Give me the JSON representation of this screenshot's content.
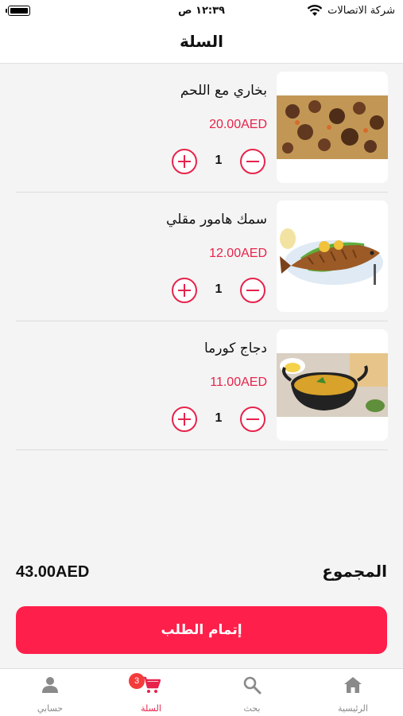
{
  "status_bar": {
    "carrier": "شركة الاتصالات",
    "time": "١٢:٣٩ ص"
  },
  "header": {
    "title": "السلة"
  },
  "cart": {
    "items": [
      {
        "name": "بخاري مع اللحم",
        "price": "20.00AED",
        "quantity": "1",
        "image": "bukhari-rice-with-meat"
      },
      {
        "name": "سمك هامور مقلي",
        "price": "12.00AED",
        "quantity": "1",
        "image": "fried-hammour-fish"
      },
      {
        "name": "دجاج كورما",
        "price": "11.00AED",
        "quantity": "1",
        "image": "chicken-korma-pot"
      }
    ]
  },
  "summary": {
    "total_label": "المجموع",
    "total_value": "43.00AED"
  },
  "checkout": {
    "label": "إتمام الطلب"
  },
  "tab_bar": {
    "tabs": [
      {
        "label": "حسابي",
        "icon": "person-icon"
      },
      {
        "label": "السلة",
        "icon": "cart-icon",
        "badge": "3",
        "active": true
      },
      {
        "label": "بحث",
        "icon": "search-icon"
      },
      {
        "label": "الرئيسية",
        "icon": "home-icon"
      }
    ]
  },
  "colors": {
    "accent": "#e7234b",
    "checkout_button": "#ff1f4b",
    "badge": "#f43b3b",
    "background": "#f4f4f4"
  }
}
